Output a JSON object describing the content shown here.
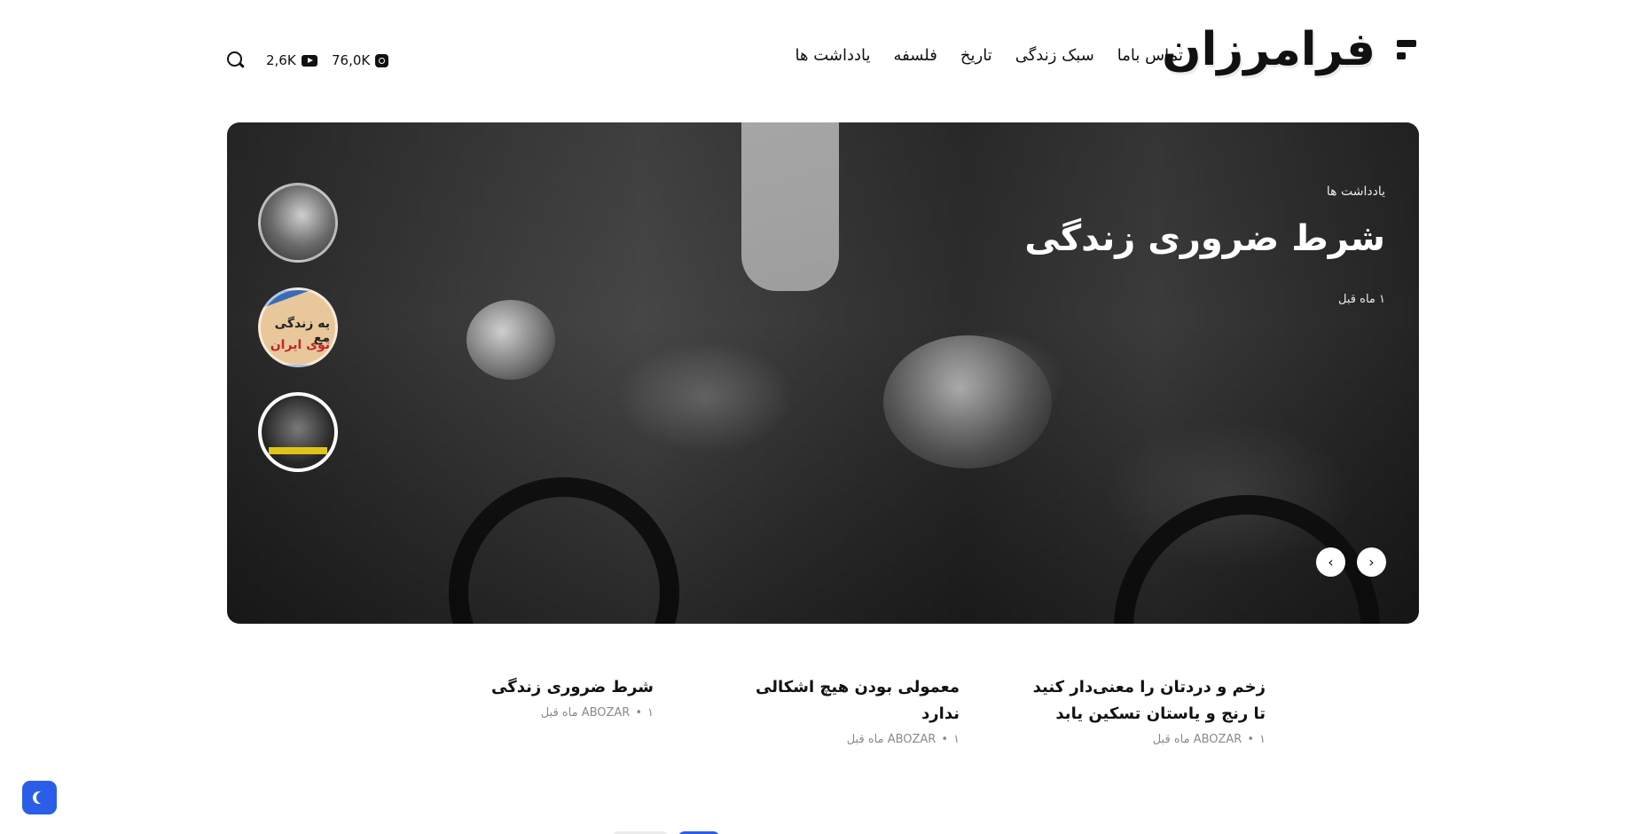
{
  "header": {
    "logo_text": "فرامرزان",
    "nav": [
      "یادداشت ها",
      "فلسفه",
      "تاریخ",
      "سبک زندگی",
      "تماس باما"
    ],
    "social": {
      "instagram_count": "76,0K",
      "youtube_count": "2,6K"
    },
    "icons": {
      "search": "search-icon",
      "youtube": "youtube-icon",
      "instagram": "instagram-icon"
    }
  },
  "hero": {
    "category": "یادداشت ها",
    "title": "شرط ضروری زندگی",
    "date": "۱ ماه قبل",
    "thumb_text_line1": "یه زندگی مع",
    "thumb_text_line2": "توی ایران",
    "prev_label": "‹",
    "next_label": "›"
  },
  "posts": [
    {
      "title": "زخم و دردتان را معنی‌دار کنید تا رنج و یاستان تسکین یابد",
      "author": "ABOZAR",
      "date": "۱ ماه قبل"
    },
    {
      "title": "معمولی بودن هیچ اشکالی ندارد",
      "author": "ABOZAR",
      "date": "۱ ماه قبل"
    },
    {
      "title": "شرط ضروری زندگی",
      "author": "ABOZAR",
      "date": "۱ ماه قبل"
    }
  ],
  "theme": {
    "accent": "#2b5ee8",
    "text": "#111111",
    "muted": "#8a8a8a"
  }
}
